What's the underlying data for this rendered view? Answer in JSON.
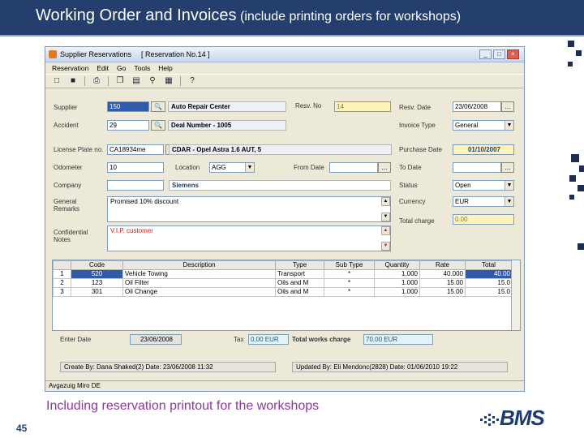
{
  "slide": {
    "title_main": "Working Order and Invoices",
    "title_sub": "(include printing orders for workshops)",
    "caption": "Including reservation printout for the workshops",
    "page_number": "45",
    "logo_text": "BMS"
  },
  "window": {
    "title_app": "Supplier Reservations",
    "title_doc": "[ Reservation No.14 ]",
    "buttons": {
      "minimize": "_",
      "maximize": "□",
      "close": "×"
    }
  },
  "menu": [
    "Reservation",
    "Edit",
    "Go",
    "Tools",
    "Help"
  ],
  "toolbar_icons": [
    "new-icon",
    "save-icon",
    "print-icon",
    "copy-icon",
    "open-icon",
    "find-icon",
    "calculator-icon",
    "help-icon"
  ],
  "form": {
    "supplier": {
      "label": "Supplier",
      "code": "150",
      "name": "Auto Repair Center"
    },
    "accident": {
      "label": "Accident",
      "code": "29",
      "name": "Deal Number - 1005"
    },
    "resv_no": {
      "label": "Resv. No",
      "value": "14"
    },
    "resv_date": {
      "label": "Resv. Date",
      "value": "23/06/2008"
    },
    "invoice_type": {
      "label": "Invoice Type",
      "value": "General"
    },
    "license_plate": {
      "label": "License Plate no.",
      "value": "CA18934me",
      "desc": "CDAR - Opel Astra 1.6 AUT, 5"
    },
    "purchase_date": {
      "label": "Purchase Date",
      "value": "01/10/2007"
    },
    "odometer": {
      "label": "Odometer",
      "value": "10"
    },
    "location": {
      "label": "Location",
      "value": "AGG"
    },
    "from_date": {
      "label": "From Date",
      "value": ""
    },
    "to_date": {
      "label": "To Date",
      "value": ""
    },
    "company": {
      "label": "Company",
      "value": "Siemens"
    },
    "status": {
      "label": "Status",
      "value": "Open"
    },
    "general_remarks": {
      "label1": "General",
      "label2": "Remarks",
      "value": "Promised 10% discount"
    },
    "currency": {
      "label": "Currency",
      "value": "EUR"
    },
    "total_charge": {
      "label": "Total charge",
      "value": "0.00"
    },
    "confidential_notes": {
      "label1": "Confidential",
      "label2": "Notes",
      "value": "V.I.P. customer"
    }
  },
  "grid": {
    "columns": [
      "",
      "Code",
      "Description",
      "Type",
      "Sub Type",
      "Quantity",
      "Rate",
      "Total"
    ],
    "rows": [
      [
        "1",
        "520",
        "Vehicle Towing",
        "Transport",
        "*",
        "1.000",
        "40.000",
        "40.00"
      ],
      [
        "2",
        "123",
        "Oil Filter",
        "Oils and M",
        "*",
        "1.000",
        "15.00",
        "15.0"
      ],
      [
        "3",
        "301",
        "Oil Change",
        "Oils and M",
        "*",
        "1.000",
        "15.00",
        "15.0"
      ]
    ]
  },
  "summary": {
    "enter_date_label": "Enter Date",
    "enter_date": "23/06/2008",
    "tax_label": "Tax",
    "tax": "0.00 EUR",
    "total_works_label": "Total works charge",
    "total_works": "70.00 EUR"
  },
  "audit": {
    "created": "Create By: Dana Shaked(2)     Date: 23/06/2008 11:32",
    "updated": "Updated By: Eli Mendonc(2828)     Date: 01/06/2010 19:22"
  },
  "statusbar": "Avgazuig Miro DE"
}
